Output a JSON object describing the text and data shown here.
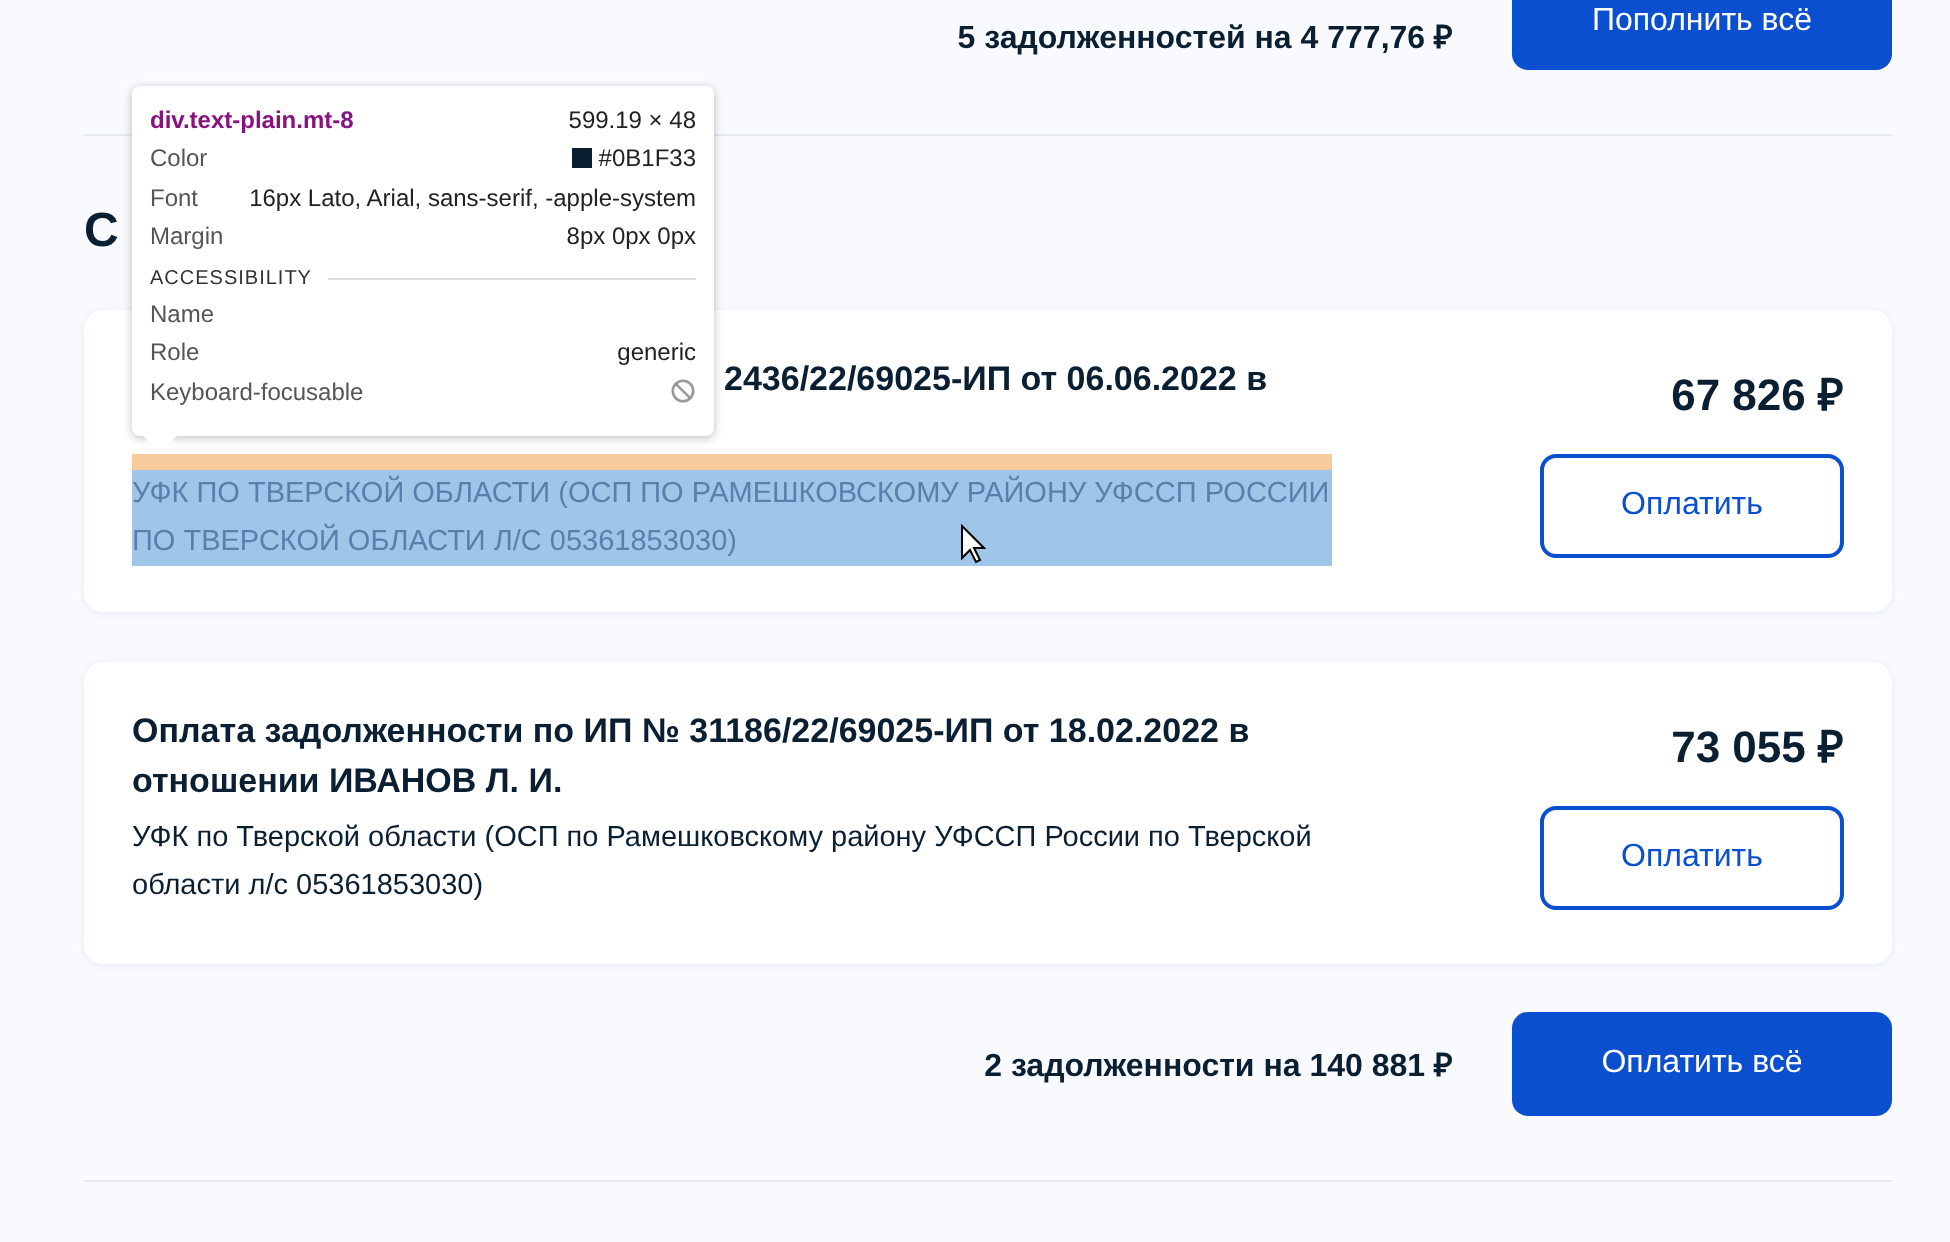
{
  "top_summary": {
    "text": "5 задолженностей на 4 777,76 ₽",
    "button": "Пополнить всё"
  },
  "section_title": "С",
  "cards": [
    {
      "title": "2436/22/69025-ИП от 06.06.2022 в",
      "title_partial": true,
      "description": "УФК ПО ТВЕРСКОЙ ОБЛАСТИ (ОСП ПО РАМЕШКОВСКОМУ РАЙОНУ УФССП РОССИИ ПО ТВЕРСКОЙ ОБЛАСТИ Л/С 05361853030)",
      "highlighted": true,
      "amount": "67 826 ₽",
      "button": "Оплатить"
    },
    {
      "title": "Оплата задолженности по ИП № 31186/22/69025-ИП от 18.02.2022 в отношении ИВАНОВ Л. И.",
      "title_partial": false,
      "description": "УФК по Тверской области (ОСП по Рамешковскому району УФССП России по Тверской области л/с 05361853030)",
      "highlighted": false,
      "amount": "73 055 ₽",
      "button": "Оплатить"
    }
  ],
  "bottom_summary": {
    "text": "2 задолженности на 140 881 ₽",
    "button": "Оплатить всё"
  },
  "inspector": {
    "selector": "div.text-plain.mt-8",
    "size": "599.19 × 48",
    "rows": [
      {
        "label": "Color",
        "value": "#0B1F33",
        "kind": "color"
      },
      {
        "label": "Font",
        "value": "16px Lato, Arial, sans-serif, -apple-system",
        "kind": "text"
      },
      {
        "label": "Margin",
        "value": "8px 0px 0px",
        "kind": "text"
      }
    ],
    "section": "ACCESSIBILITY",
    "a11y": [
      {
        "label": "Name"
      },
      {
        "label": "Role",
        "value": "generic"
      },
      {
        "label": "Keyboard-focusable",
        "focusable": false
      }
    ]
  }
}
